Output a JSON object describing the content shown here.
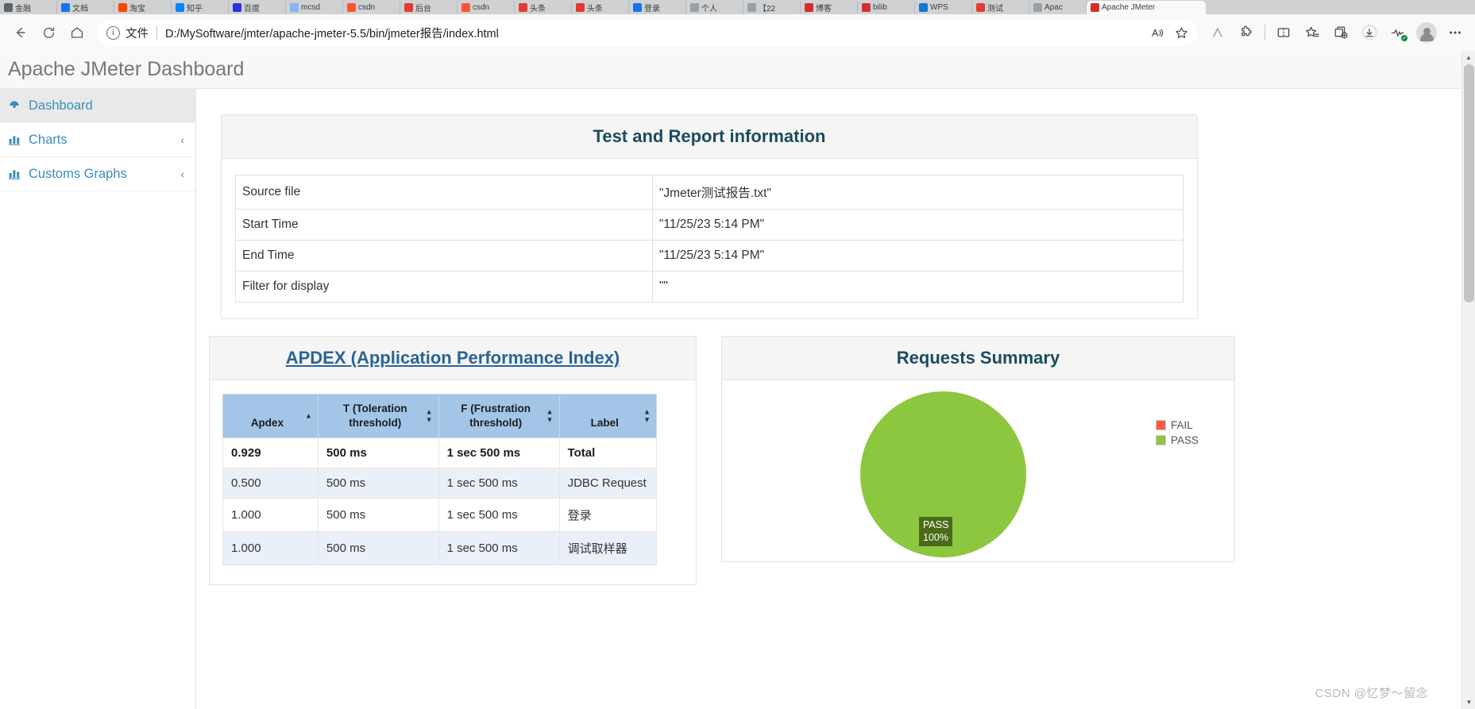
{
  "browser": {
    "tabs": [
      {
        "label": "金融",
        "color": "#5f6368"
      },
      {
        "label": "文档",
        "color": "#1a73e8"
      },
      {
        "label": "淘宝",
        "color": "#ff4400"
      },
      {
        "label": "知乎",
        "color": "#0084ff"
      },
      {
        "label": "百度",
        "color": "#2932e1"
      },
      {
        "label": "mcsd",
        "color": "#8ab4f8"
      },
      {
        "label": "csdn",
        "color": "#fc5531"
      },
      {
        "label": "后台",
        "color": "#e53935"
      },
      {
        "label": "csdn",
        "color": "#fc5531"
      },
      {
        "label": "头条",
        "color": "#e53935"
      },
      {
        "label": "头条",
        "color": "#e53935"
      },
      {
        "label": "登录",
        "color": "#1a73e8"
      },
      {
        "label": "个人",
        "color": "#9aa0a6"
      },
      {
        "label": "【22",
        "color": "#9aa0a6"
      },
      {
        "label": "博客",
        "color": "#d32f2f"
      },
      {
        "label": "bilib",
        "color": "#d32f2f"
      },
      {
        "label": "WPS",
        "color": "#1976d2"
      },
      {
        "label": "测试",
        "color": "#e53935"
      },
      {
        "label": "Apac",
        "color": "#9aa0a6"
      }
    ],
    "active_tab": {
      "label": "Apache JMeter",
      "color": "#d93025"
    },
    "nav": {
      "back_icon": "back-arrow-icon",
      "reload_icon": "reload-icon",
      "home_icon": "home-icon"
    },
    "omnibox": {
      "info_icon": "info-icon",
      "scheme_label": "文件",
      "url": "D:/MySoftware/jmter/apache-jmeter-5.5/bin/jmeter报告/index.html",
      "read_aloud_icon": "read-aloud-icon",
      "favorite_icon": "star-icon"
    },
    "toolbar_icons": [
      "copilot-icon",
      "extensions-icon",
      "split-screen-icon",
      "add-favorite-icon",
      "collections-icon",
      "downloads-icon",
      "browser-essentials-icon",
      "profile-avatar",
      "settings-more-icon"
    ]
  },
  "app": {
    "brand": "Apache JMeter Dashboard"
  },
  "sidebar": {
    "items": [
      {
        "label": "Dashboard",
        "icon": "dashboard-gauge-icon",
        "caret": "",
        "active": true
      },
      {
        "label": "Charts",
        "icon": "bar-chart-icon",
        "caret": "‹",
        "active": false
      },
      {
        "label": "Customs Graphs",
        "icon": "bar-chart-icon",
        "caret": "‹",
        "active": false
      }
    ]
  },
  "info_panel": {
    "title": "Test and Report information",
    "rows": [
      {
        "key": "Source file",
        "value": "\"Jmeter测试报告.txt\""
      },
      {
        "key": "Start Time",
        "value": "\"11/25/23 5:14 PM\""
      },
      {
        "key": "End Time",
        "value": "\"11/25/23 5:14 PM\""
      },
      {
        "key": "Filter for display",
        "value": "\"\""
      }
    ]
  },
  "apdex_panel": {
    "title": "APDEX (Application Performance Index)",
    "columns": [
      {
        "label": "Apdex",
        "sort": "asc"
      },
      {
        "label": "T (Toleration threshold)",
        "sort": "both"
      },
      {
        "label": "F (Frustration threshold)",
        "sort": "both"
      },
      {
        "label": "Label",
        "sort": "both"
      }
    ],
    "rows": [
      {
        "apdex": "0.929",
        "t": "500 ms",
        "f": "1 sec 500 ms",
        "label": "Total",
        "total": true
      },
      {
        "apdex": "0.500",
        "t": "500 ms",
        "f": "1 sec 500 ms",
        "label": "JDBC Request",
        "total": false
      },
      {
        "apdex": "1.000",
        "t": "500 ms",
        "f": "1 sec 500 ms",
        "label": "登录",
        "total": false
      },
      {
        "apdex": "1.000",
        "t": "500 ms",
        "f": "1 sec 500 ms",
        "label": "调试取样器",
        "total": false
      }
    ]
  },
  "requests_summary": {
    "title": "Requests Summary",
    "slice_label_name": "PASS",
    "slice_label_value": "100%",
    "legend": [
      {
        "label": "FAIL",
        "color": "#ff5a44"
      },
      {
        "label": "PASS",
        "color": "#8dc63f"
      }
    ]
  },
  "chart_data": {
    "type": "pie",
    "title": "Requests Summary",
    "categories": [
      "FAIL",
      "PASS"
    ],
    "values": [
      0,
      100
    ],
    "unit": "%",
    "colors": [
      "#ff5a44",
      "#8dc63f"
    ],
    "legend_position": "right",
    "annotations": [
      "PASS 100%"
    ]
  },
  "watermark": {
    "text": "CSDN @忆梦～留念"
  }
}
